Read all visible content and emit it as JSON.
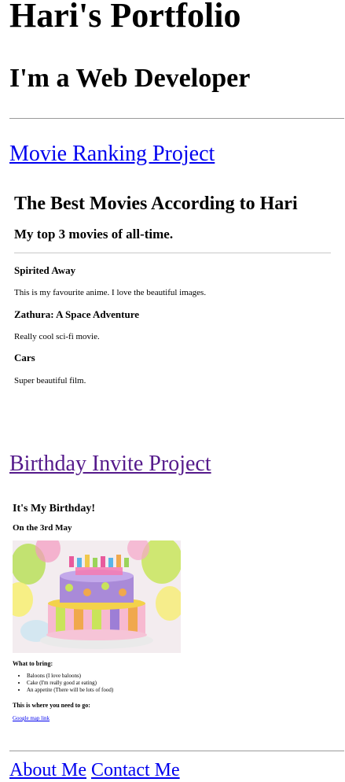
{
  "header": {
    "title": "Hari's Portfolio",
    "subtitle": "I'm a Web Developer"
  },
  "projects": [
    {
      "link_label": "Movie Ranking Project",
      "page": {
        "title": "The Best Movies According to Hari",
        "subtitle": "My top 3 movies of all-time.",
        "movies": [
          {
            "name": "Spirited Away",
            "description": "This is my favourite anime. I love the beautiful images."
          },
          {
            "name": "Zathura: A Space Adventure",
            "description": "Really cool sci-fi movie."
          },
          {
            "name": "Cars",
            "description": "Super beautiful film."
          }
        ]
      }
    },
    {
      "link_label": "Birthday Invite Project",
      "page": {
        "title": "It's My Birthday!",
        "date": "On the 3rd May",
        "image_icon": "birthday-cake-image",
        "bring_heading": "What to bring:",
        "bring_items": [
          "Baloons (I love baloons)",
          "Cake (I'm really good at eating)",
          "An appetite (There will be lots of food)"
        ],
        "where_heading": "This is where you need to go:",
        "map_link": "Google map link"
      }
    }
  ],
  "footer": {
    "about_label": "About Me",
    "contact_label": "Contact Me"
  },
  "colors": {
    "link": "#0000ee",
    "visited_link": "#551a8b",
    "rule": "#9a9a9a"
  }
}
